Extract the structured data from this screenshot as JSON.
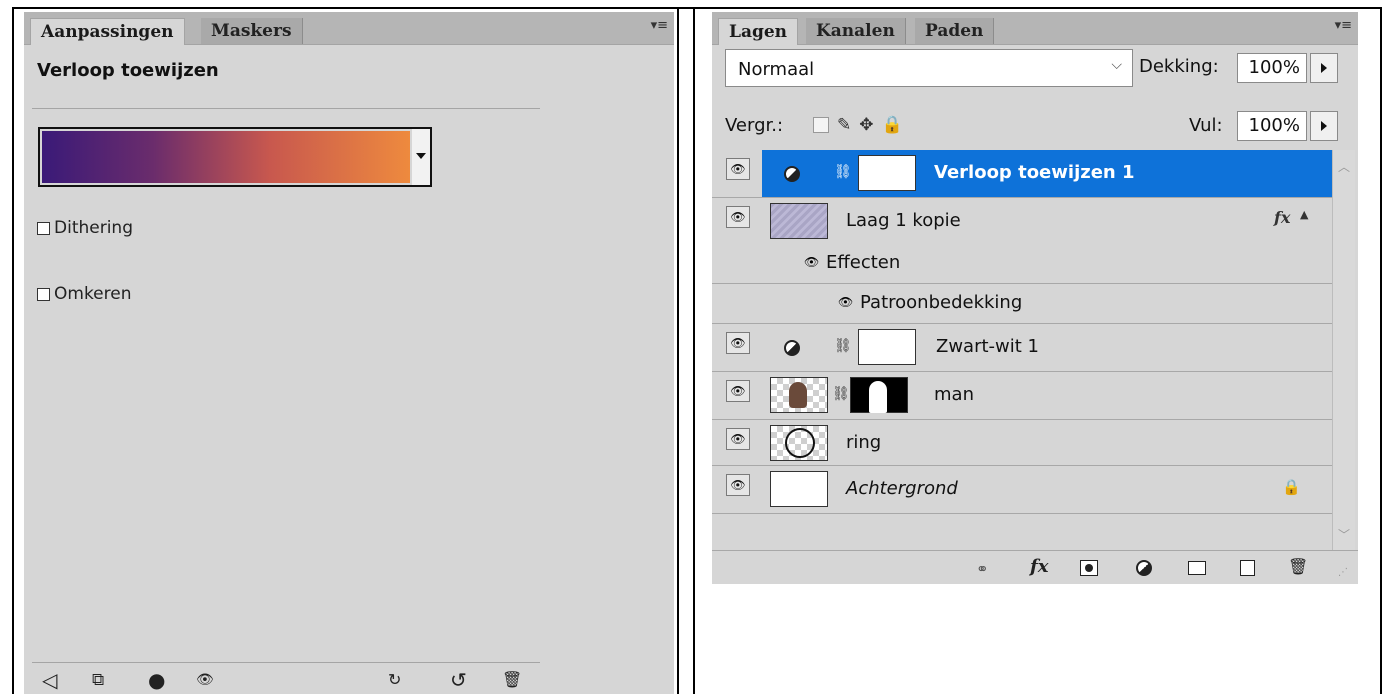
{
  "adjustments_panel": {
    "tabs": [
      {
        "label": "Aanpassingen",
        "active": true
      },
      {
        "label": "Maskers",
        "active": false
      }
    ],
    "menu_icon": "panel-menu-icon",
    "title": "Verloop toewijzen",
    "gradient": {
      "colors": [
        "#3a1a78",
        "#6a2c6c",
        "#c8584e",
        "#ee8a3e"
      ]
    },
    "options": [
      {
        "label": "Dithering",
        "checked": false
      },
      {
        "label": "Omkeren",
        "checked": false
      }
    ],
    "footer_icons": [
      "back-arrow-icon",
      "expand-view-icon",
      "clip-to-layer-icon",
      "visibility-eye-icon",
      "view-previous-state-icon",
      "reset-icon",
      "trash-icon"
    ]
  },
  "layers_panel": {
    "tabs": [
      {
        "label": "Lagen",
        "active": true
      },
      {
        "label": "Kanalen",
        "active": false
      },
      {
        "label": "Paden",
        "active": false
      }
    ],
    "blend_mode": "Normaal",
    "opacity_label": "Dekking:",
    "opacity_value": "100%",
    "lock_label": "Vergr.:",
    "fill_label": "Vul:",
    "fill_value": "100%",
    "layers": [
      {
        "name": "Verloop toewijzen 1",
        "kind": "adjustment",
        "selected": true
      },
      {
        "name": "Laag 1 kopie",
        "kind": "pattern-layer",
        "has_fx": true
      },
      {
        "name": "Effecten",
        "kind": "effects-group"
      },
      {
        "name": "Patroonbedekking",
        "kind": "effect"
      },
      {
        "name": "Zwart-wit 1",
        "kind": "adjustment"
      },
      {
        "name": "man",
        "kind": "image-with-mask"
      },
      {
        "name": "ring",
        "kind": "image"
      },
      {
        "name": "Achtergrond",
        "kind": "background",
        "locked": true
      }
    ],
    "fx_symbol": "fx",
    "footer_icons": [
      "link-layers-icon",
      "layer-style-fx-icon",
      "add-mask-icon",
      "new-adjustment-icon",
      "new-group-icon",
      "new-layer-icon",
      "delete-layer-icon"
    ]
  }
}
